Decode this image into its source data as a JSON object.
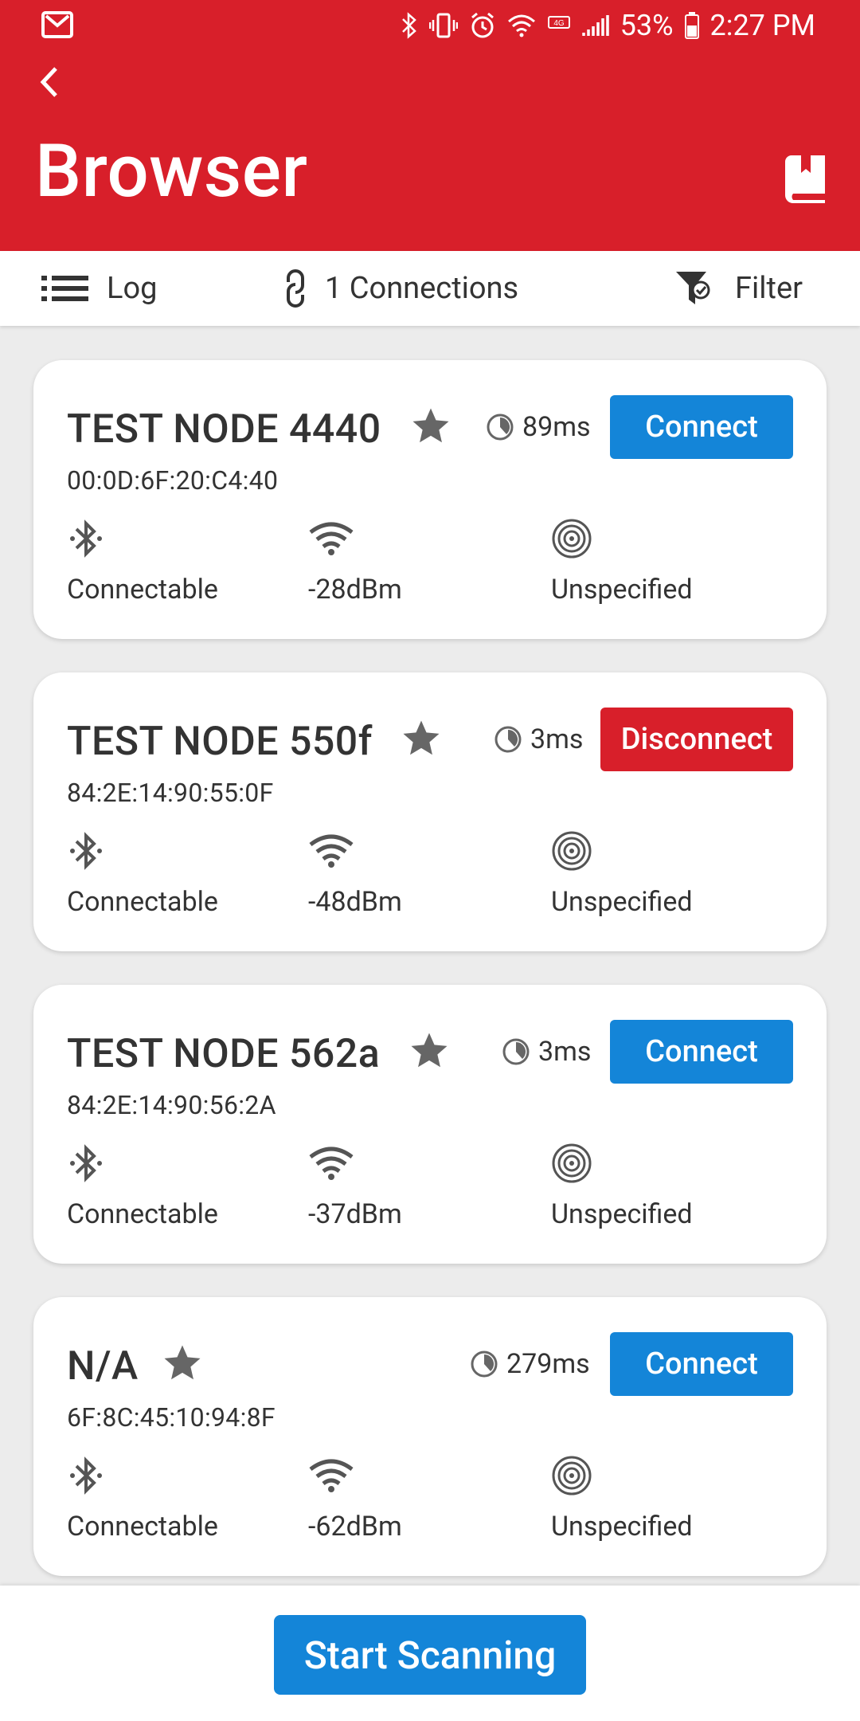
{
  "status_bar": {
    "battery": "53%",
    "time": "2:27 PM",
    "icons": [
      "mail-icon",
      "bluetooth-icon",
      "vibrate-icon",
      "alarm-icon",
      "wifi-icon",
      "lte-icon",
      "signal-icon",
      "battery-icon"
    ]
  },
  "header": {
    "title": "Browser",
    "back_icon": "back-arrow-icon",
    "book_icon": "book-icon"
  },
  "toolbar": {
    "log_label": "Log",
    "connections_label": "1 Connections",
    "filter_label": "Filter"
  },
  "devices": [
    {
      "name": "TEST NODE 4440",
      "address": "00:0D:6F:20:C4:40",
      "interval": "89ms",
      "action": "Connect",
      "connectable": "Connectable",
      "rssi": "-28dBm",
      "type": "Unspecified"
    },
    {
      "name": "TEST NODE 550f",
      "address": "84:2E:14:90:55:0F",
      "interval": "3ms",
      "action": "Disconnect",
      "connectable": "Connectable",
      "rssi": "-48dBm",
      "type": "Unspecified"
    },
    {
      "name": "TEST NODE 562a",
      "address": "84:2E:14:90:56:2A",
      "interval": "3ms",
      "action": "Connect",
      "connectable": "Connectable",
      "rssi": "-37dBm",
      "type": "Unspecified"
    },
    {
      "name": "N/A",
      "address": "6F:8C:45:10:94:8F",
      "interval": "279ms",
      "action": "Connect",
      "connectable": "Connectable",
      "rssi": "-62dBm",
      "type": "Unspecified"
    }
  ],
  "bottom": {
    "scan_label": "Start Scanning"
  },
  "colors": {
    "brand_red": "#d81f2a",
    "primary_blue": "#1485d8",
    "text_dark": "#333333",
    "icon_gray": "#666666"
  }
}
